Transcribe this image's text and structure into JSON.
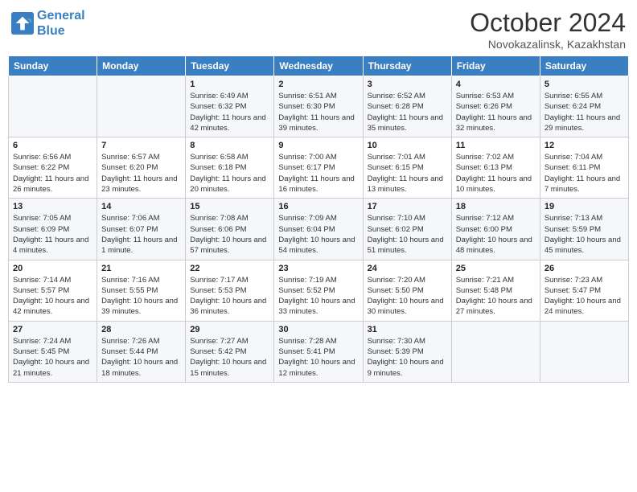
{
  "header": {
    "logo_line1": "General",
    "logo_line2": "Blue",
    "month": "October 2024",
    "location": "Novokazalinsk, Kazakhstan"
  },
  "weekdays": [
    "Sunday",
    "Monday",
    "Tuesday",
    "Wednesday",
    "Thursday",
    "Friday",
    "Saturday"
  ],
  "weeks": [
    [
      {
        "day": "",
        "info": ""
      },
      {
        "day": "",
        "info": ""
      },
      {
        "day": "1",
        "info": "Sunrise: 6:49 AM\nSunset: 6:32 PM\nDaylight: 11 hours and 42 minutes."
      },
      {
        "day": "2",
        "info": "Sunrise: 6:51 AM\nSunset: 6:30 PM\nDaylight: 11 hours and 39 minutes."
      },
      {
        "day": "3",
        "info": "Sunrise: 6:52 AM\nSunset: 6:28 PM\nDaylight: 11 hours and 35 minutes."
      },
      {
        "day": "4",
        "info": "Sunrise: 6:53 AM\nSunset: 6:26 PM\nDaylight: 11 hours and 32 minutes."
      },
      {
        "day": "5",
        "info": "Sunrise: 6:55 AM\nSunset: 6:24 PM\nDaylight: 11 hours and 29 minutes."
      }
    ],
    [
      {
        "day": "6",
        "info": "Sunrise: 6:56 AM\nSunset: 6:22 PM\nDaylight: 11 hours and 26 minutes."
      },
      {
        "day": "7",
        "info": "Sunrise: 6:57 AM\nSunset: 6:20 PM\nDaylight: 11 hours and 23 minutes."
      },
      {
        "day": "8",
        "info": "Sunrise: 6:58 AM\nSunset: 6:18 PM\nDaylight: 11 hours and 20 minutes."
      },
      {
        "day": "9",
        "info": "Sunrise: 7:00 AM\nSunset: 6:17 PM\nDaylight: 11 hours and 16 minutes."
      },
      {
        "day": "10",
        "info": "Sunrise: 7:01 AM\nSunset: 6:15 PM\nDaylight: 11 hours and 13 minutes."
      },
      {
        "day": "11",
        "info": "Sunrise: 7:02 AM\nSunset: 6:13 PM\nDaylight: 11 hours and 10 minutes."
      },
      {
        "day": "12",
        "info": "Sunrise: 7:04 AM\nSunset: 6:11 PM\nDaylight: 11 hours and 7 minutes."
      }
    ],
    [
      {
        "day": "13",
        "info": "Sunrise: 7:05 AM\nSunset: 6:09 PM\nDaylight: 11 hours and 4 minutes."
      },
      {
        "day": "14",
        "info": "Sunrise: 7:06 AM\nSunset: 6:07 PM\nDaylight: 11 hours and 1 minute."
      },
      {
        "day": "15",
        "info": "Sunrise: 7:08 AM\nSunset: 6:06 PM\nDaylight: 10 hours and 57 minutes."
      },
      {
        "day": "16",
        "info": "Sunrise: 7:09 AM\nSunset: 6:04 PM\nDaylight: 10 hours and 54 minutes."
      },
      {
        "day": "17",
        "info": "Sunrise: 7:10 AM\nSunset: 6:02 PM\nDaylight: 10 hours and 51 minutes."
      },
      {
        "day": "18",
        "info": "Sunrise: 7:12 AM\nSunset: 6:00 PM\nDaylight: 10 hours and 48 minutes."
      },
      {
        "day": "19",
        "info": "Sunrise: 7:13 AM\nSunset: 5:59 PM\nDaylight: 10 hours and 45 minutes."
      }
    ],
    [
      {
        "day": "20",
        "info": "Sunrise: 7:14 AM\nSunset: 5:57 PM\nDaylight: 10 hours and 42 minutes."
      },
      {
        "day": "21",
        "info": "Sunrise: 7:16 AM\nSunset: 5:55 PM\nDaylight: 10 hours and 39 minutes."
      },
      {
        "day": "22",
        "info": "Sunrise: 7:17 AM\nSunset: 5:53 PM\nDaylight: 10 hours and 36 minutes."
      },
      {
        "day": "23",
        "info": "Sunrise: 7:19 AM\nSunset: 5:52 PM\nDaylight: 10 hours and 33 minutes."
      },
      {
        "day": "24",
        "info": "Sunrise: 7:20 AM\nSunset: 5:50 PM\nDaylight: 10 hours and 30 minutes."
      },
      {
        "day": "25",
        "info": "Sunrise: 7:21 AM\nSunset: 5:48 PM\nDaylight: 10 hours and 27 minutes."
      },
      {
        "day": "26",
        "info": "Sunrise: 7:23 AM\nSunset: 5:47 PM\nDaylight: 10 hours and 24 minutes."
      }
    ],
    [
      {
        "day": "27",
        "info": "Sunrise: 7:24 AM\nSunset: 5:45 PM\nDaylight: 10 hours and 21 minutes."
      },
      {
        "day": "28",
        "info": "Sunrise: 7:26 AM\nSunset: 5:44 PM\nDaylight: 10 hours and 18 minutes."
      },
      {
        "day": "29",
        "info": "Sunrise: 7:27 AM\nSunset: 5:42 PM\nDaylight: 10 hours and 15 minutes."
      },
      {
        "day": "30",
        "info": "Sunrise: 7:28 AM\nSunset: 5:41 PM\nDaylight: 10 hours and 12 minutes."
      },
      {
        "day": "31",
        "info": "Sunrise: 7:30 AM\nSunset: 5:39 PM\nDaylight: 10 hours and 9 minutes."
      },
      {
        "day": "",
        "info": ""
      },
      {
        "day": "",
        "info": ""
      }
    ]
  ]
}
